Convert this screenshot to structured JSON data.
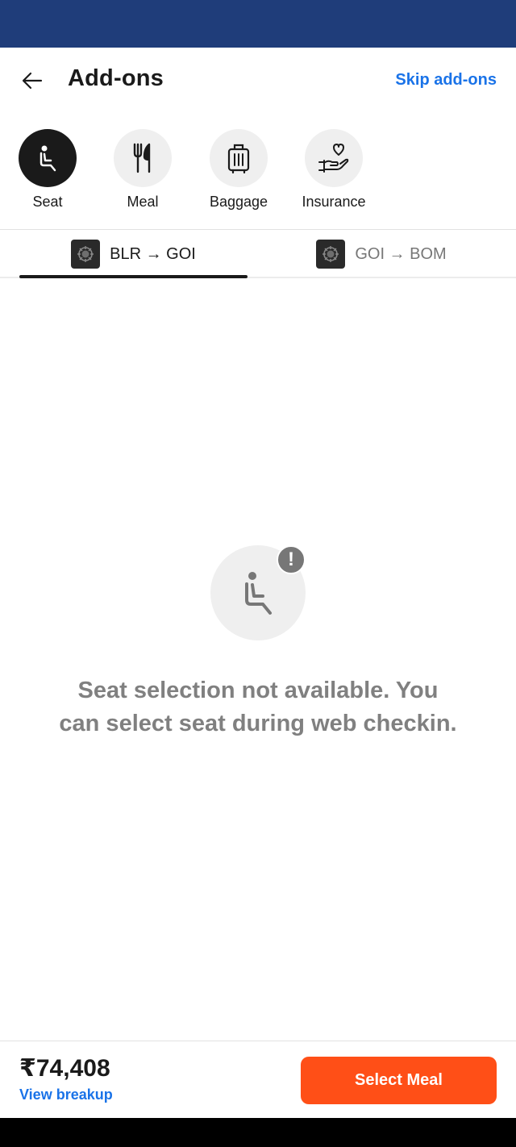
{
  "header": {
    "title": "Add-ons",
    "skip_label": "Skip add-ons"
  },
  "addons": [
    {
      "label": "Seat",
      "icon": "seat-icon",
      "active": true
    },
    {
      "label": "Meal",
      "icon": "cutlery-icon",
      "active": false
    },
    {
      "label": "Baggage",
      "icon": "luggage-icon",
      "active": false
    },
    {
      "label": "Insurance",
      "icon": "heart-hand-icon",
      "active": false
    }
  ],
  "tabs": [
    {
      "label": "BLR → GOI",
      "active": true,
      "icon": "airline-logo-icon"
    },
    {
      "label": "GOI → BOM",
      "active": false,
      "icon": "airline-logo-icon"
    }
  ],
  "empty_state": {
    "message": "Seat selection not available. You can select seat during web checkin.",
    "icon": "seat-icon",
    "badge": "!"
  },
  "footer": {
    "price": "₹74,408",
    "breakup_label": "View breakup",
    "cta_label": "Select Meal"
  },
  "colors": {
    "status_bar": "#1f3d7a",
    "link": "#1a73e8",
    "cta": "#ff4f17",
    "active_addon": "#1a1a1a"
  }
}
